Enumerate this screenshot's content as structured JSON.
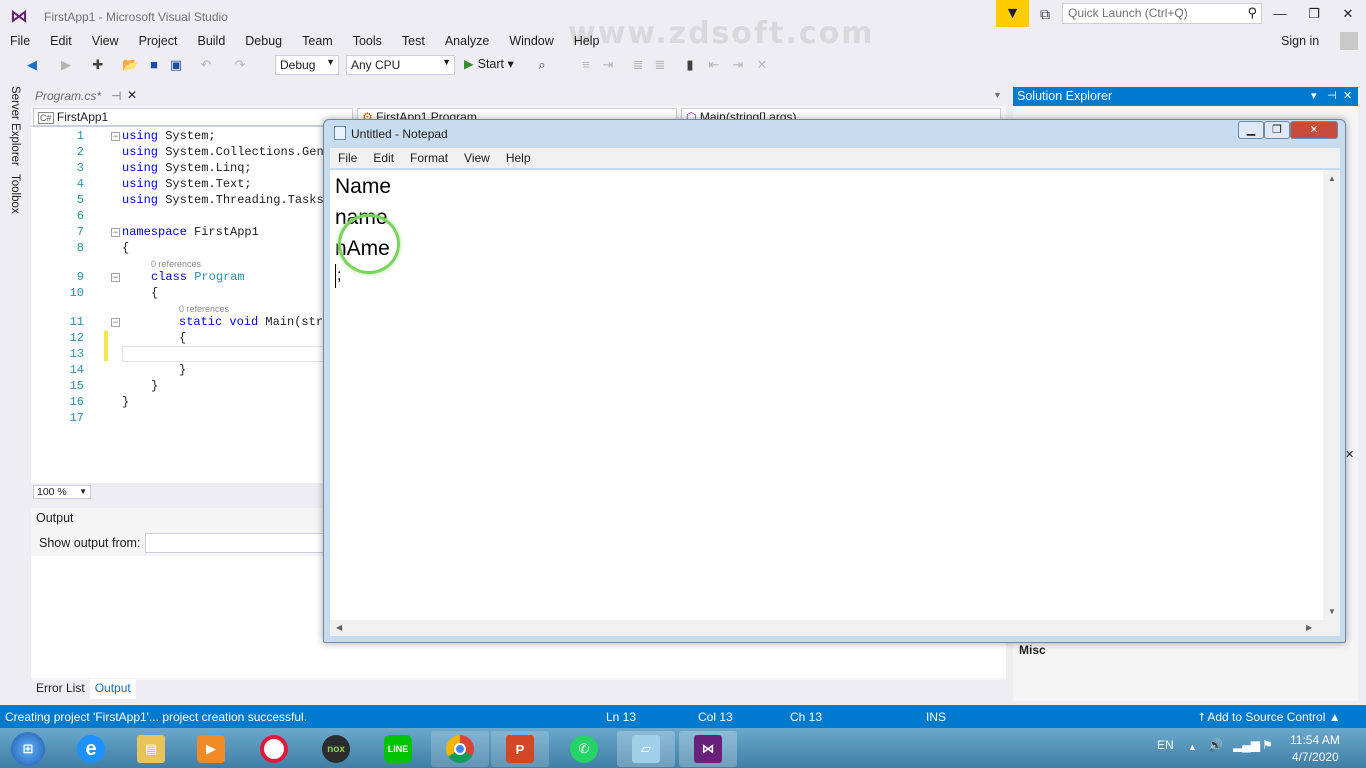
{
  "window": {
    "title": "FirstApp1 - Microsoft Visual Studio",
    "quick_launch_placeholder": "Quick Launch (Ctrl+Q)",
    "sign_in": "Sign in"
  },
  "watermark": "www.zdsoft.com",
  "menu": [
    "File",
    "Edit",
    "View",
    "Project",
    "Build",
    "Debug",
    "Team",
    "Tools",
    "Test",
    "Analyze",
    "Window",
    "Help"
  ],
  "toolbar": {
    "config": "Debug",
    "platform": "Any CPU",
    "start_label": "Start"
  },
  "side_tabs": [
    "Server Explorer",
    "Toolbox"
  ],
  "editor": {
    "tab_label": "Program.cs*",
    "nav_project": "FirstApp1",
    "nav_class": "FirstApp1.Program",
    "nav_member": "Main(string[] args)",
    "zoom": "100 %",
    "line_numbers": [
      "1",
      "2",
      "3",
      "4",
      "5",
      "6",
      "7",
      "8",
      "9",
      "10",
      "11",
      "12",
      "13",
      "14",
      "15",
      "16",
      "17"
    ],
    "code": {
      "l1": "System;",
      "l2": "System.Collections.Gene",
      "l3": "System.Linq;",
      "l4": "System.Text;",
      "l5": "System.Threading.Tasks",
      "l7": "FirstApp1",
      "l8": "{",
      "l9": "Program",
      "l10": "{",
      "l11_sig": "Main(stri",
      "l12": "{",
      "l14": "}",
      "l15": "}",
      "l16": "}",
      "kw_using": "using",
      "kw_namespace": "namespace",
      "kw_class": "class",
      "kw_static_void": "static void",
      "refs": "0 references"
    }
  },
  "output": {
    "title": "Output",
    "show_from": "Show output from:"
  },
  "bottom_tabs": [
    "Error List",
    "Output"
  ],
  "solution_explorer": {
    "title": "Solution Explorer",
    "misc": "Misc"
  },
  "notepad": {
    "title": "Untitled - Notepad",
    "menu": [
      "File",
      "Edit",
      "Format",
      "View",
      "Help"
    ],
    "lines": [
      "Name",
      "name",
      "nAme",
      ";"
    ]
  },
  "status": {
    "message": "Creating project 'FirstApp1'... project creation successful.",
    "ln": "Ln 13",
    "col": "Col 13",
    "ch": "Ch 13",
    "mode": "INS",
    "source_control": "Add to Source Control"
  },
  "tray": {
    "lang": "EN",
    "time": "11:54 AM",
    "date": "4/7/2020"
  },
  "colors": {
    "vs_blue": "#007acc",
    "accent_yellow": "#ffcc00",
    "keyword": "#0000ff",
    "type": "#2b91af",
    "highlight_circle": "#7ad35c"
  }
}
